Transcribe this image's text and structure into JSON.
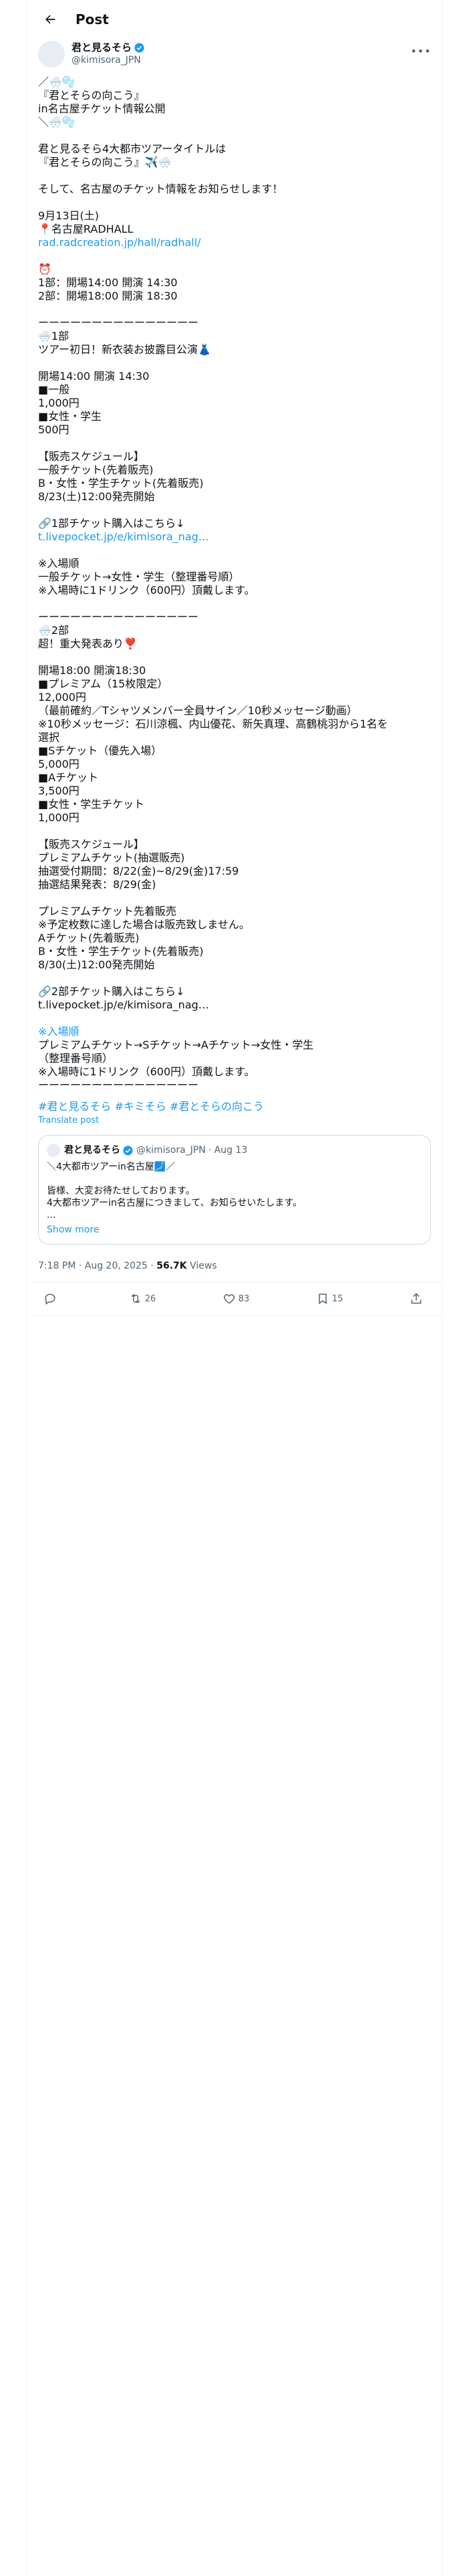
{
  "header": {
    "title": "Post"
  },
  "author": {
    "name": "君と見るそら",
    "handle": "@kimisora_JPN"
  },
  "tweet": {
    "lines": [
      "／🌨️🫧",
      "『君とそらの向こう』",
      "in名古屋チケット情報公開",
      "＼🌨️🫧",
      "",
      "君と見るそら4大都市ツアータイトルは",
      "『君とそらの向こう』✈️🌨️",
      "",
      "そして、名古屋のチケット情報をお知らせします！",
      "",
      "9月13日(土)",
      "📍名古屋RADHALL",
      "rad.radcreation.jp/hall/radhall/",
      "",
      "⏰",
      "1部：開場14:00 開演 14:30",
      "2部：開場18:00 開演 18:30",
      "",
      "ーーーーーーーーーーーーーーー",
      "🌨️1部",
      "ツアー初日！新衣装お披露目公演👗",
      "",
      "開場14:00 開演 14:30",
      "■一般",
      "1,000円",
      "■女性・学生",
      "500円",
      "",
      "【販売スケジュール】",
      "一般チケット(先着販売)",
      "B・女性・学生チケット(先着販売)",
      "8/23(土)12:00発売開始",
      "",
      "🔗1部チケット購入はこちら↓",
      "t.livepocket.jp/e/kimisora_nag…",
      "",
      "※入場順",
      "一般チケット→女性・学生（整理番号順）",
      "※入場時に1ドリンク（600円）頂戴します。",
      "",
      "ーーーーーーーーーーーーーーー",
      "🌨️2部",
      "超！重大発表あり❣️",
      "",
      "開場18:00 開演18:30",
      "■プレミアム（15枚限定）",
      "12,000円",
      "（最前確約／Tシャツメンバー全員サイン／10秒メッセージ動画）",
      "※10秒メッセージ：石川涼楓、内山優花、新矢真理、高鶴桃羽から1名を",
      "選択",
      "■Sチケット（優先入場）",
      "5,000円",
      "■Aチケット",
      "3,500円",
      "■女性・学生チケット",
      "1,000円",
      "",
      "【販売スケジュール】",
      "プレミアムチケット(抽選販売)",
      "抽選受付期間：8/22(金)~8/29(金)17:59",
      "抽選結果発表：8/29(金)",
      "",
      "プレミアムチケット先着販売",
      "※予定枚数に達した場合は販売致しません。",
      "Aチケット(先着販売)",
      "B・女性・学生チケット(先着販売)",
      "8/30(土)12:00発売開始",
      "",
      "🔗2部チケット購入はこちら↓",
      "t.livepocket.jp/e/kimisora_nag…",
      "",
      "※入場順",
      "プレミアムチケット→Sチケット→Aチケット→女性・学生",
      "（整理番号順）",
      "※入場時に1ドリンク（600円）頂戴します。",
      "ーーーーーーーーーーーーーーー"
    ],
    "link_lines": [
      12,
      34,
      71
    ],
    "hashtags": "#君と見るそら #キミそら #君とそらの向こう",
    "translate": "Translate post"
  },
  "quote": {
    "name": "君と見るそら",
    "handle": "@kimisora_JPN",
    "date": "· Aug 13",
    "lines": [
      "＼4大都市ツアーin名古屋🗾／",
      "",
      "皆様、大変お待たせしております。",
      "4大都市ツアーin名古屋につきまして、お知らせいたします。",
      "..."
    ],
    "show_more": "Show more"
  },
  "meta": {
    "time": "7:18 PM · Aug 20, 2025 · ",
    "views": "56.7K",
    "views_label": " Views"
  },
  "actions": {
    "replies": "",
    "reposts": "26",
    "likes": "83",
    "bookmarks": "15"
  },
  "colors": {
    "accent": "#1d9bf0",
    "verified": "#1d9bf0",
    "muted": "#536471"
  }
}
